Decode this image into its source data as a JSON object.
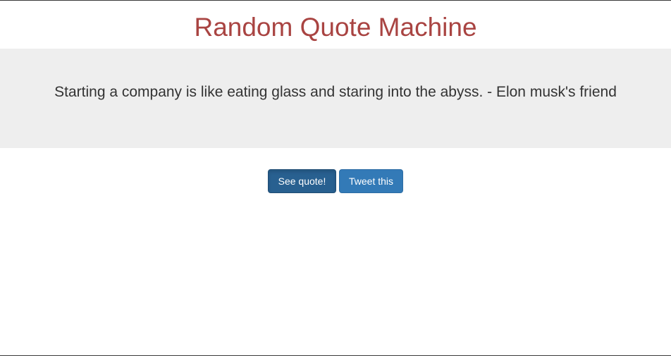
{
  "header": {
    "title": "Random Quote Machine"
  },
  "quote": {
    "text": "Starting a company is like eating glass and staring into the abyss. - Elon musk's friend"
  },
  "actions": {
    "see_quote_label": "See quote!",
    "tweet_label": "Tweet this"
  },
  "colors": {
    "title": "#a94442",
    "panel_bg": "#eeeeee",
    "primary_button": "#337ab7",
    "primary_button_active": "#286090"
  }
}
